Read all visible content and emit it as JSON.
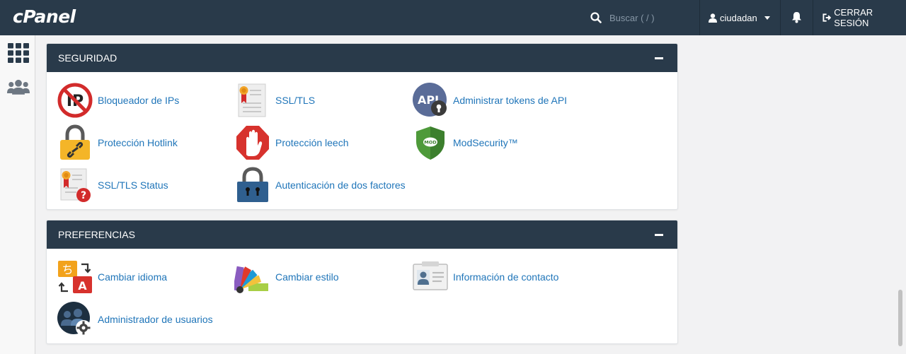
{
  "header": {
    "logo": "cPanel",
    "search_placeholder": "Buscar ( / )",
    "username": "ciudadan",
    "logout_label": "CERRAR SESIÓN"
  },
  "sidebar": {
    "items": [
      {
        "name": "apps-grid",
        "icon": "grid-icon"
      },
      {
        "name": "users",
        "icon": "users-icon"
      }
    ]
  },
  "sections": [
    {
      "title": "SEGURIDAD",
      "items": [
        {
          "label": "Bloqueador de IPs",
          "icon": "ip-blocker-icon"
        },
        {
          "label": "SSL/TLS",
          "icon": "ssl-certificate-icon"
        },
        {
          "label": "Administrar tokens de API",
          "icon": "api-token-icon"
        },
        {
          "label": "Protección Hotlink",
          "icon": "hotlink-lock-icon"
        },
        {
          "label": "Protección leech",
          "icon": "leech-hand-icon"
        },
        {
          "label": "ModSecurity™",
          "icon": "modsecurity-shield-icon"
        },
        {
          "label": "SSL/TLS Status",
          "icon": "ssl-status-icon"
        },
        {
          "label": "Autenticación de dos factores",
          "icon": "two-factor-lock-icon"
        }
      ]
    },
    {
      "title": "PREFERENCIAS",
      "items": [
        {
          "label": "Cambiar idioma",
          "icon": "language-icon"
        },
        {
          "label": "Cambiar estilo",
          "icon": "style-palette-icon"
        },
        {
          "label": "Información de contacto",
          "icon": "contact-card-icon"
        },
        {
          "label": "Administrador de usuarios",
          "icon": "user-manager-icon"
        }
      ]
    }
  ],
  "colors": {
    "header_bg": "#293a4a",
    "link": "#1f75b9",
    "page_bg": "#f2f2f3"
  }
}
